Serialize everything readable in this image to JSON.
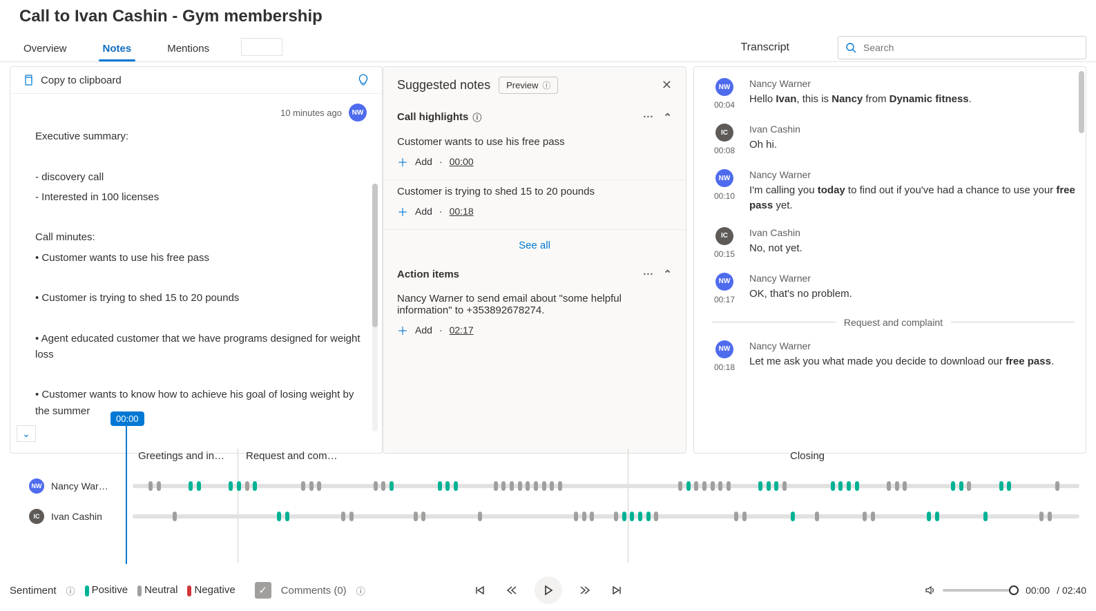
{
  "pageTitle": "Call to Ivan Cashin - Gym membership",
  "tabs": {
    "overview": "Overview",
    "notes": "Notes",
    "mentions": "Mentions"
  },
  "transcriptLabel": "Transcript",
  "search": {
    "placeholder": "Search"
  },
  "copyLabel": "Copy to clipboard",
  "notesMeta": {
    "time": "10 minutes ago",
    "initials": "NW"
  },
  "notesBody": {
    "h1": "Executive summary:",
    "b1": "- discovery call",
    "b2": "- Interested in 100 licenses",
    "h2": "Call minutes:",
    "m1": "• Customer wants to use his free pass",
    "m2": "• Customer is trying to shed 15 to 20 pounds",
    "m3": "• Agent educated customer that we have programs designed for weight loss",
    "m4": "• Customer wants to know how to achieve his goal of losing weight by the summer"
  },
  "sugg": {
    "title": "Suggested notes",
    "preview": "Preview",
    "highlights": {
      "title": "Call highlights",
      "items": [
        {
          "text": "Customer wants to use his free pass",
          "ts": "00:00"
        },
        {
          "text": "Customer is trying to shed 15 to 20 pounds",
          "ts": "00:18"
        }
      ]
    },
    "seeAll": "See all",
    "addLabel": "Add",
    "actionItems": {
      "title": "Action items",
      "text": "Nancy Warner to send email about \"some helpful information\" to +353892678274.",
      "ts": "02:17"
    }
  },
  "transcript": [
    {
      "who": "NW",
      "name": "Nancy Warner",
      "time": "00:04",
      "html": "Hello <b>Ivan</b>, this is <b>Nancy</b> from <b>Dynamic fitness</b>."
    },
    {
      "who": "IC",
      "name": "Ivan Cashin",
      "time": "00:08",
      "html": "Oh hi."
    },
    {
      "who": "NW",
      "name": "Nancy Warner",
      "time": "00:10",
      "html": "I'm calling you <b>today</b> to find out if you've had a chance to use your <b>free pass</b> yet."
    },
    {
      "who": "IC",
      "name": "Ivan Cashin",
      "time": "00:15",
      "html": "No, not yet."
    },
    {
      "who": "NW",
      "name": "Nancy Warner",
      "time": "00:17",
      "html": "OK, that's no problem."
    }
  ],
  "transDivider": "Request and complaint",
  "transcript2": [
    {
      "who": "NW",
      "name": "Nancy Warner",
      "time": "00:18",
      "html": "Let me ask you what made you decide to download our <b>free pass</b>."
    }
  ],
  "timeline": {
    "playhead": "00:00",
    "segments": {
      "greet": "Greetings and in…",
      "req": "Request and com…",
      "closing": "Closing"
    },
    "speakers": [
      {
        "initials": "NW",
        "name": "Nancy War…",
        "avatar": "nw"
      },
      {
        "initials": "IC",
        "name": "Ivan Cashin",
        "avatar": "ic"
      }
    ]
  },
  "footer": {
    "sentiment": "Sentiment",
    "legend": {
      "pos": "Positive",
      "neu": "Neutral",
      "neg": "Negative"
    },
    "comments": "Comments (0)",
    "time": {
      "cur": "00:00",
      "total": "/ 02:40"
    }
  }
}
